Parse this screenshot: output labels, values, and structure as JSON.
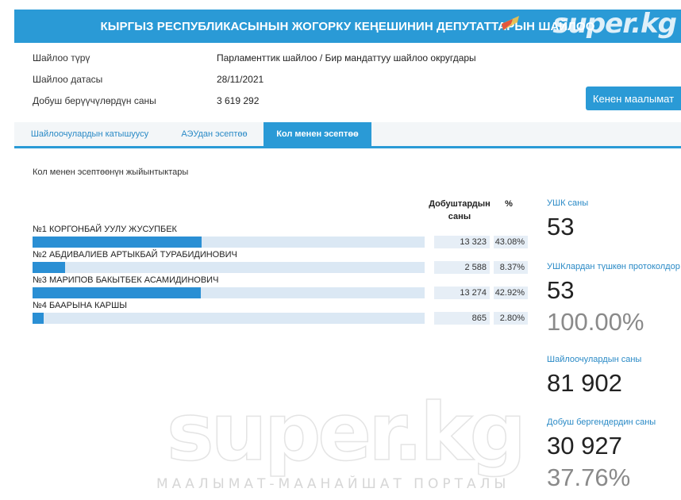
{
  "header": {
    "title": "КЫРГЫЗ РЕСПУБЛИКАСЫНЫН ЖОГОРКУ КЕҢЕШИНИН ДЕПУТАТТАРЫН ШАЙЛОО"
  },
  "watermark": {
    "brand": "super.kg",
    "subtitle": "МААЛЫМАТ-МААНАЙШАТ ПОРТАЛЫ"
  },
  "info": {
    "type_label": "Шайлоо түрү",
    "type_value": "Парламенттик шайлоо / Бир мандаттуу шайлоо округдары",
    "date_label": "Шайлоо датасы",
    "date_value": "28/11/2021",
    "voters_label": "Добуш берүүчүлөрдүн саны",
    "voters_value": "3 619 292",
    "more_button": "Кенен маалымат"
  },
  "tabs": [
    {
      "label": "Шайлоочулардын катышуусу",
      "active": false
    },
    {
      "label": "АЭУдан эсептөө",
      "active": false
    },
    {
      "label": "Кол менен эсептөө",
      "active": true
    }
  ],
  "results": {
    "title": "Кол менен эсептөөнүн жыйынтыктары",
    "col_votes": "Добуштардын саны",
    "col_pct": "%",
    "candidates": [
      {
        "name": "№1 КОРГОНБАЙ УУЛУ ЖУСУПБЕК",
        "votes": "13 323",
        "pct": "43.08%",
        "share": 0.4308
      },
      {
        "name": "№2 АБДИВАЛИЕВ АРТЫКБАЙ ТУРАБИДИНОВИЧ",
        "votes": "2 588",
        "pct": "8.37%",
        "share": 0.0837
      },
      {
        "name": "№3 МАРИПОВ БАКЫТБЕК АСАМИДИНОВИЧ",
        "votes": "13 274",
        "pct": "42.92%",
        "share": 0.4292
      },
      {
        "name": "№4 БААРЫНА КАРШЫ",
        "votes": "865",
        "pct": "2.80%",
        "share": 0.028
      }
    ]
  },
  "stats": {
    "ushk_label": "УШК саны",
    "ushk_value": "53",
    "protocols_label": "УШКлардан түшкөн протоколдор",
    "protocols_value": "53",
    "protocols_pct": "100.00%",
    "voters_label": "Шайлоочулардын саны",
    "voters_value": "81 902",
    "turnout_label": "Добуш бергендердин саны",
    "turnout_value": "30 927",
    "turnout_pct": "37.76%"
  },
  "colors": {
    "accent": "#2a9ad6",
    "bar": "#2a8fd4",
    "track": "#dbe8f4"
  }
}
